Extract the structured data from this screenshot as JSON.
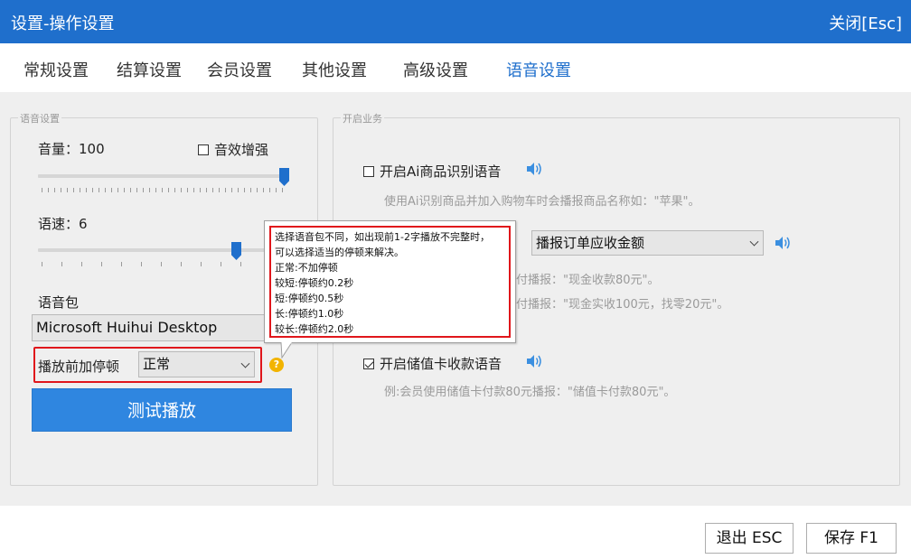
{
  "window": {
    "title": "设置-操作设置",
    "close_label": "关闭[Esc]"
  },
  "tabs": [
    {
      "label": "常规设置"
    },
    {
      "label": "结算设置"
    },
    {
      "label": "会员设置"
    },
    {
      "label": "其他设置"
    },
    {
      "label": "高级设置"
    },
    {
      "label": "语音设置",
      "active": true
    }
  ],
  "voice_settings": {
    "legend": "语音设置",
    "volume_label": "音量：100",
    "volume_value": 100,
    "sound_enhance_label": "音效增强",
    "sound_enhance_checked": false,
    "speed_label": "语速：6",
    "speed_value": 6,
    "voice_pack_label": "语音包",
    "voice_pack_value": "Microsoft Huihui Desktop",
    "pause_label": "播放前加停顿",
    "pause_value": "正常",
    "help_symbol": "?",
    "test_button": "测试播放"
  },
  "tooltip": {
    "lines": [
      "选择语音包不同，如出现前1-2字播放不完整时，",
      "可以选择适当的停顿来解决。",
      "正常:不加停顿",
      "较短:停顿约0.2秒",
      "短:停顿约0.5秒",
      "长:停顿约1.0秒",
      "较长:停顿约2.0秒"
    ]
  },
  "business": {
    "legend": "开启业务",
    "ai_label": "开启Ai商品识别语音",
    "ai_checked": false,
    "ai_hint": "使用Ai识别商品并加入购物车时会播报商品名称如：\"苹果\"。",
    "order_select": "播报订单应收金额",
    "order_hint1": "付播报：\"现金收款80元\"。",
    "order_hint2": "付播报：\"现金实收100元，找零20元\"。",
    "stored_label": "开启储值卡收款语音",
    "stored_checked": true,
    "stored_hint": "例:会员使用储值卡付款80元播报：\"储值卡付款80元\"。"
  },
  "footer": {
    "exit_label": "退出 ESC",
    "save_label": "保存 F1"
  },
  "colors": {
    "accent": "#1f6fcc",
    "highlight": "#e0161b",
    "help": "#f2b400"
  }
}
